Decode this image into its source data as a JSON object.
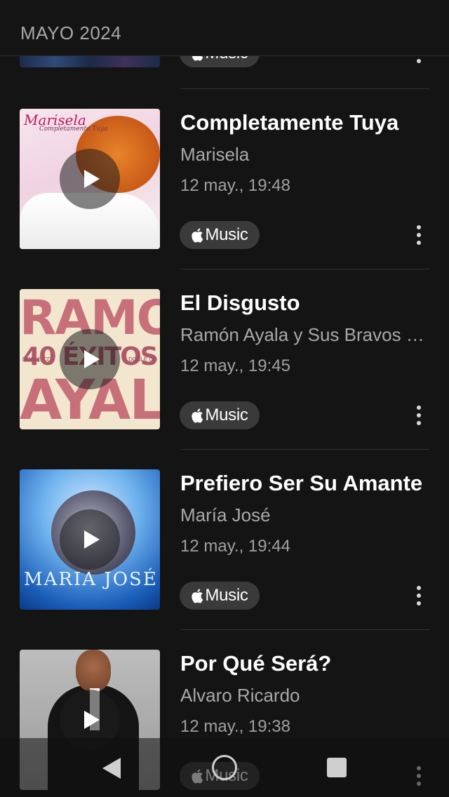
{
  "header": {
    "label": "MAYO 2024"
  },
  "badge_label": "Music",
  "items": [
    {
      "title": "",
      "artist": "",
      "time": ""
    },
    {
      "title": "Completamente Tuya",
      "artist": "Marisela",
      "time": "12 may., 19:48",
      "art": {
        "name": "Marisela",
        "subtitle": "Completamente Tuya"
      }
    },
    {
      "title": "El Disgusto",
      "artist": "Ramón Ayala y Sus Bravos del Norte",
      "time": "12 may., 19:45",
      "art": {
        "line1": "RAMON",
        "line2": "40 ÉXITOS",
        "line3": "AYALA",
        "side": "DOBLE CD"
      }
    },
    {
      "title": "Prefiero Ser Su Amante",
      "artist": "María José",
      "time": "12 may., 19:44",
      "art": {
        "text": "MARIA JOSÉ"
      }
    },
    {
      "title": "Por Qué Será?",
      "artist": "Alvaro Ricardo",
      "time": "12 may., 19:38"
    }
  ],
  "colors": {
    "background": "#141414",
    "badge": "#3a3a3a",
    "secondary_text": "#a8a8a8"
  }
}
